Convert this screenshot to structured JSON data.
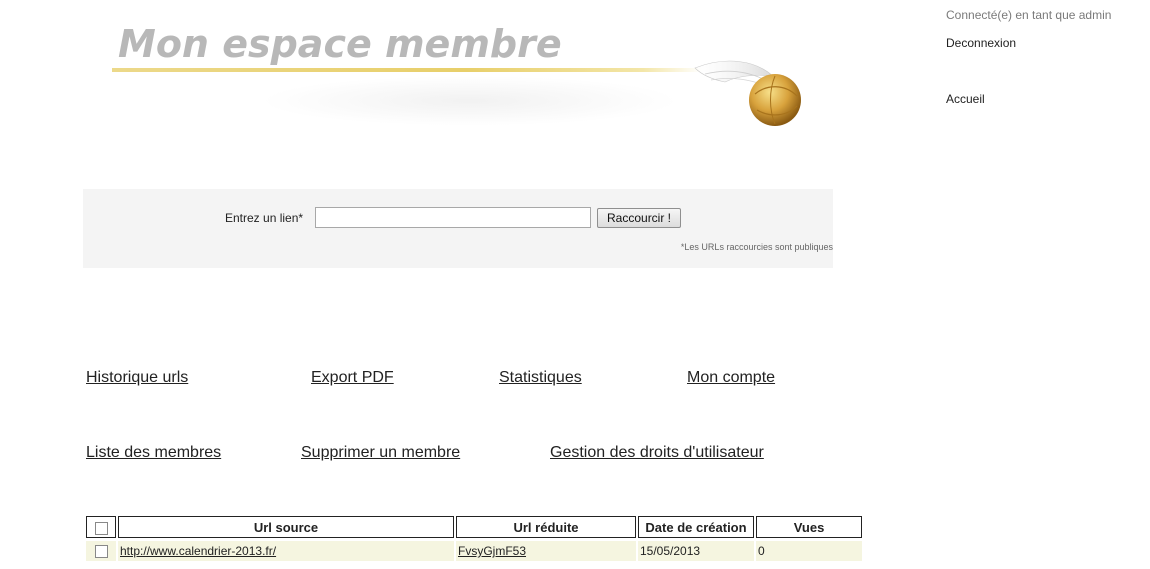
{
  "header": {
    "title": "Mon espace membre"
  },
  "user_nav": {
    "status": "Connecté(e) en tant que admin",
    "logout": "Deconnexion",
    "home": "Accueil"
  },
  "form": {
    "label": "Entrez un lien*",
    "input_value": "",
    "button": "Raccourcir !",
    "note": "*Les URLs raccourcies sont publiques"
  },
  "menu": {
    "row1": [
      "Historique urls",
      "Export PDF",
      "Statistiques",
      "Mon compte"
    ],
    "row2": [
      "Liste des membres",
      "Supprimer un membre",
      "Gestion des droits d'utilisateur"
    ]
  },
  "table": {
    "headers": [
      "Url source",
      "Url réduite",
      "Date de création",
      "Vues"
    ],
    "rows": [
      {
        "source": "http://www.calendrier-2013.fr/",
        "short": "FvsyGjmF53",
        "date": "15/05/2013",
        "views": "0"
      }
    ]
  },
  "colors": {
    "title": "#b8b8b8",
    "row_background": "#f5f5e0",
    "form_background": "#f4f4f4",
    "banner_line": "#e8cf6a"
  }
}
